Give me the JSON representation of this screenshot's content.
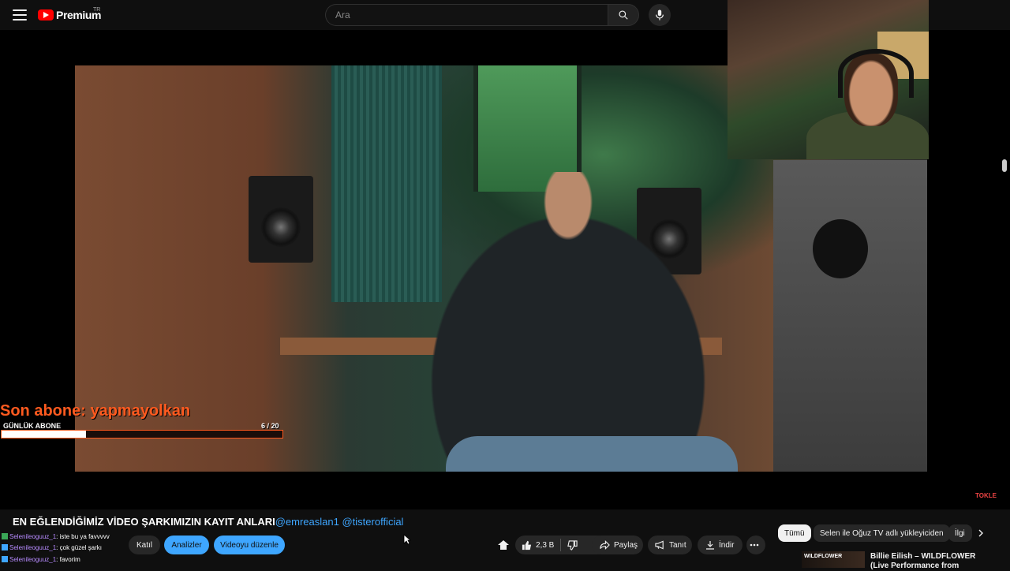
{
  "header": {
    "logo_text": "Premium",
    "country_code": "TR",
    "search_placeholder": "Ara"
  },
  "overlay": {
    "last_subscriber": "Son abone: yapmayolkan",
    "daily_label": "GÜNLÜK ABONE",
    "goal_count": "6  / 20",
    "goal_progress": 0.3,
    "watermark": "TOKLE"
  },
  "video": {
    "title": "EN EĞLENDİĞİMİZ VİDEO ŞARKIMIZIN KAYIT ANLARI",
    "tags": [
      "@emreaslan1",
      "@tisterofficial"
    ]
  },
  "chat": [
    {
      "user": "Selenileoguuz_1",
      "text": ": iste bu ya favvvvv"
    },
    {
      "user": "Selenileoguuz_1",
      "text": ": çok güzel şarkı"
    },
    {
      "user": "Selenileoguuz_1",
      "text": ": favorim"
    }
  ],
  "channel_buttons": {
    "join": "Katıl",
    "analytics": "Analizler",
    "edit": "Videoyu düzenle"
  },
  "actions": {
    "likes": "2,3 B",
    "share": "Paylaş",
    "promote": "Tanıt",
    "download": "İndir"
  },
  "chips": {
    "all": "Tümü",
    "uploader": "Selen ile Oğuz TV adlı yükleyiciden",
    "related": "İlgi"
  },
  "recommendation": {
    "thumb_label": "WILDFLOWER",
    "title": "Billie Eilish – WILDFLOWER (Live Performance from"
  },
  "colors": {
    "brand": "#ff0000",
    "accent_blue": "#3ea6ff",
    "overlay_orange": "#ff5a1f"
  }
}
